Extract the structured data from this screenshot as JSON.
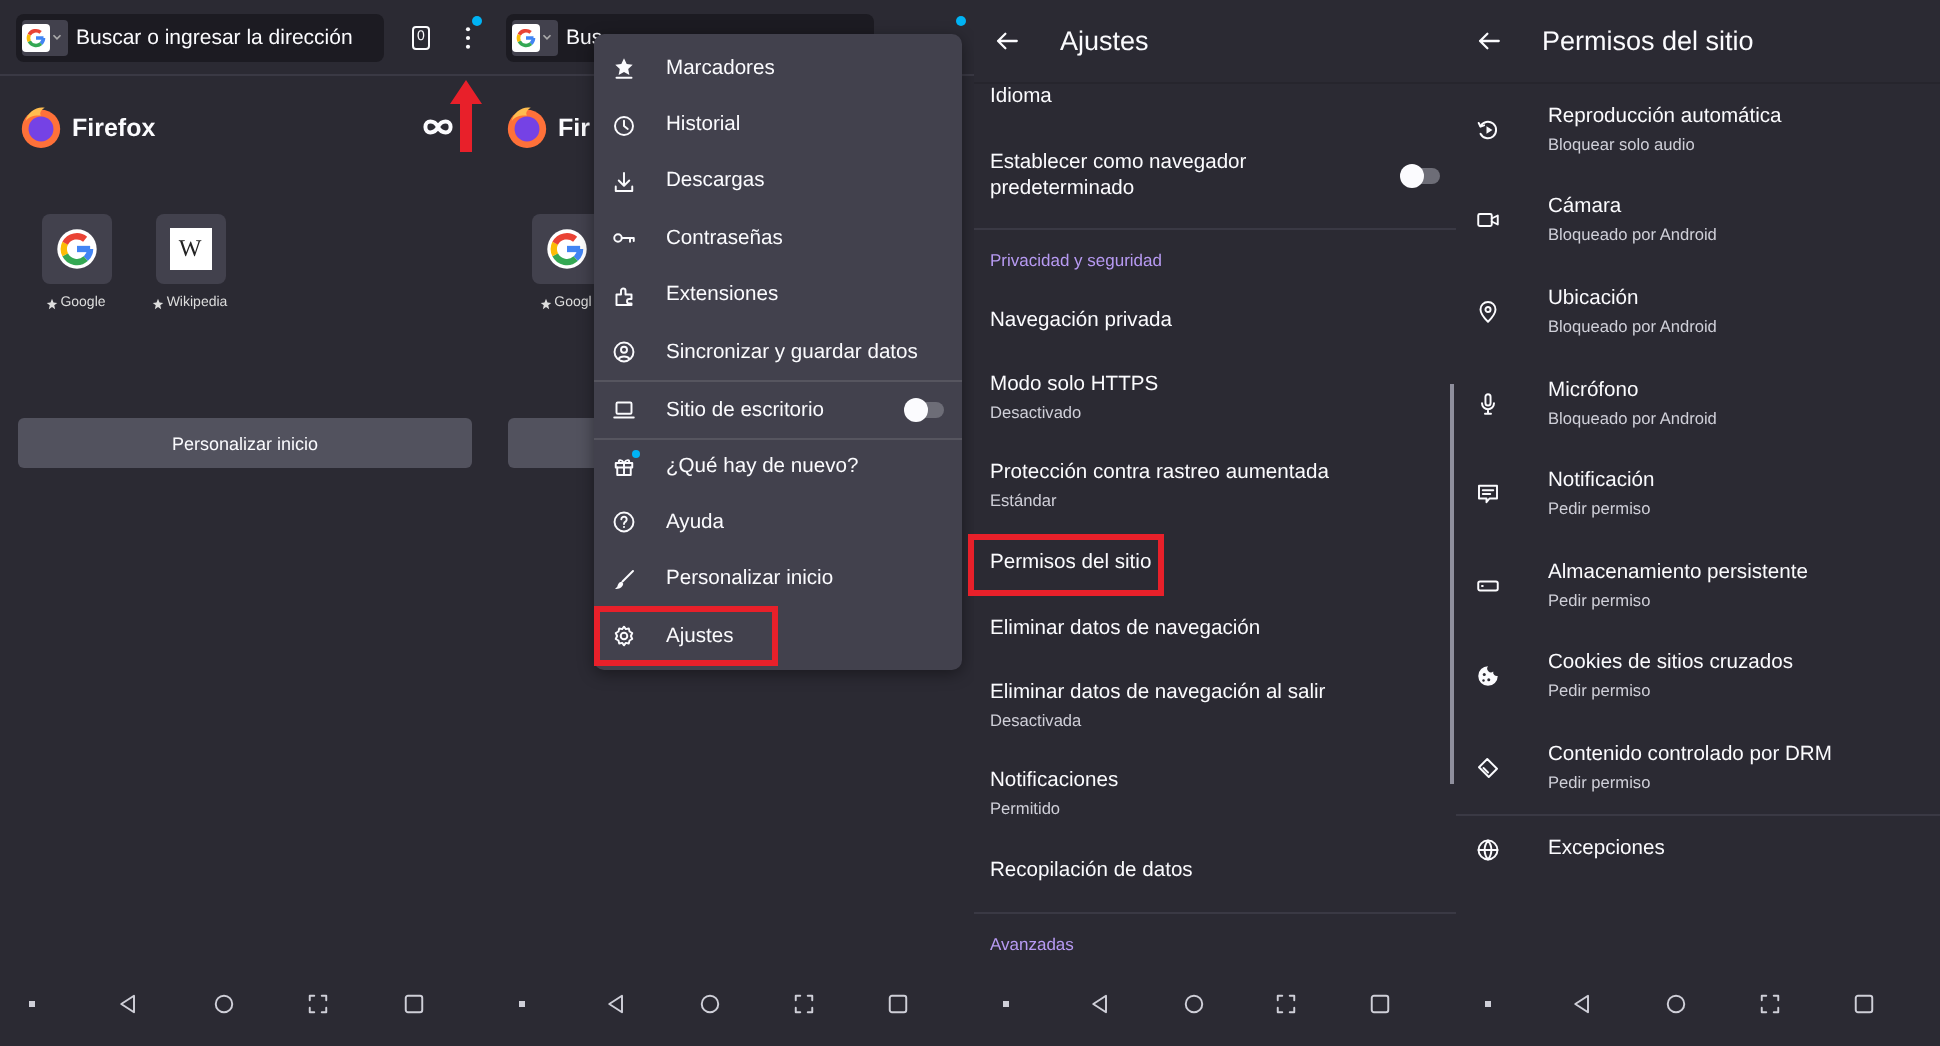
{
  "home": {
    "address_bar": {
      "placeholder": "Buscar o ingresar la dirección"
    },
    "tab_count": "0",
    "menu_notification": true,
    "brand": "Firefox",
    "shortcuts": [
      {
        "label": "Google",
        "kind": "google"
      },
      {
        "label": "Wikipedia",
        "kind": "wikipedia",
        "logo_text": "W"
      }
    ],
    "button": "Personalizar inicio",
    "annotation_arrow": true
  },
  "home_with_menu": {
    "address_bar": {
      "placeholder": "Bus"
    },
    "menu_notification": true,
    "brand": "Fir",
    "shortcuts": [
      {
        "label": "Googl",
        "kind": "google"
      }
    ],
    "menu": {
      "groups": [
        [
          {
            "label": "Marcadores",
            "highlighted": false
          },
          {
            "label": "Historial",
            "highlighted": false
          },
          {
            "label": "Descargas",
            "highlighted": false
          },
          {
            "label": "Contraseñas",
            "highlighted": false
          },
          {
            "label": "Extensiones",
            "highlighted": false
          },
          {
            "label": "Sincronizar y guardar datos",
            "highlighted": false
          }
        ],
        [
          {
            "label": "Sitio de escritorio",
            "kind": "toggle",
            "on": false,
            "highlighted": false
          }
        ],
        [
          {
            "label": "¿Qué hay de nuevo?",
            "notification": true,
            "highlighted": false
          },
          {
            "label": "Ayuda",
            "highlighted": false
          },
          {
            "label": "Personalizar inicio",
            "highlighted": false
          },
          {
            "label": "Ajustes",
            "highlighted": true
          }
        ]
      ]
    }
  },
  "settings": {
    "title": "Ajustes",
    "items": [
      {
        "kind": "item",
        "title": "Idioma",
        "highlighted": false
      },
      {
        "kind": "toggle",
        "title": "Establecer como navegador predeterminado",
        "on": false,
        "highlighted": false
      },
      {
        "kind": "section",
        "title": "Privacidad y seguridad"
      },
      {
        "kind": "item",
        "title": "Navegación privada",
        "highlighted": false
      },
      {
        "kind": "item",
        "title": "Modo solo HTTPS",
        "subtitle": "Desactivado",
        "highlighted": false
      },
      {
        "kind": "item",
        "title": "Protección contra rastreo aumentada",
        "subtitle": "Estándar",
        "highlighted": false
      },
      {
        "kind": "item",
        "title": "Permisos del sitio",
        "highlighted": true
      },
      {
        "kind": "item",
        "title": "Eliminar datos de navegación",
        "highlighted": false
      },
      {
        "kind": "item",
        "title": "Eliminar datos de navegación al salir",
        "subtitle": "Desactivada",
        "highlighted": false
      },
      {
        "kind": "item",
        "title": "Notificaciones",
        "subtitle": "Permitido",
        "highlighted": false
      },
      {
        "kind": "item",
        "title": "Recopilación de datos",
        "highlighted": false
      },
      {
        "kind": "section",
        "title": "Avanzadas"
      }
    ]
  },
  "site_permissions": {
    "title": "Permisos del sitio",
    "items": [
      {
        "title": "Reproducción automática",
        "subtitle": "Bloquear solo audio"
      },
      {
        "title": "Cámara",
        "subtitle": "Bloqueado por Android"
      },
      {
        "title": "Ubicación",
        "subtitle": "Bloqueado por Android"
      },
      {
        "title": "Micrófono",
        "subtitle": "Bloqueado por Android"
      },
      {
        "title": "Notificación",
        "subtitle": "Pedir permiso"
      },
      {
        "title": "Almacenamiento persistente",
        "subtitle": "Pedir permiso"
      },
      {
        "title": "Cookies de sitios cruzados",
        "subtitle": "Pedir permiso"
      },
      {
        "title": "Contenido controlado por DRM",
        "subtitle": "Pedir permiso"
      }
    ],
    "footer_item": {
      "title": "Excepciones"
    }
  }
}
